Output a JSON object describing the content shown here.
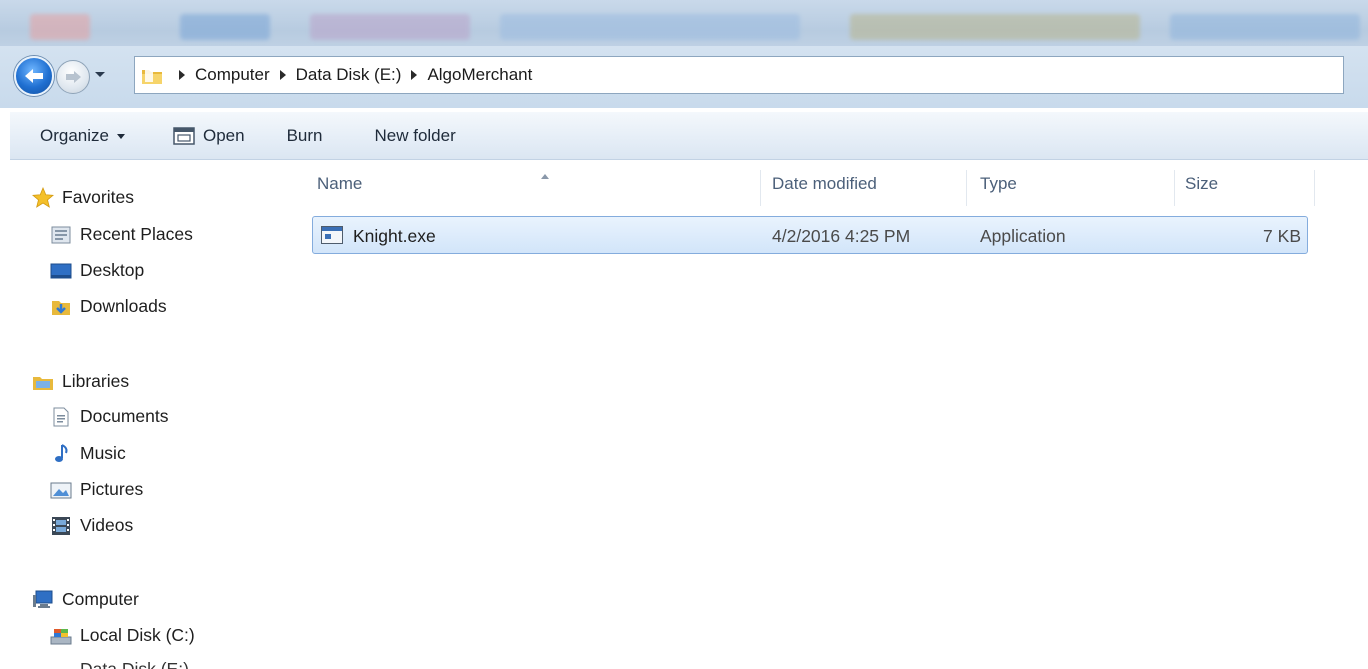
{
  "address": {
    "crumbs": [
      "Computer",
      "Data Disk (E:)",
      "AlgoMerchant"
    ]
  },
  "toolbar": {
    "organize_label": "Organize",
    "open_label": "Open",
    "burn_label": "Burn",
    "new_folder_label": "New folder"
  },
  "nav": {
    "favorites": "Favorites",
    "recent_places": "Recent Places",
    "desktop": "Desktop",
    "downloads": "Downloads",
    "libraries": "Libraries",
    "documents": "Documents",
    "music": "Music",
    "pictures": "Pictures",
    "videos": "Videos",
    "computer": "Computer",
    "local_disk": "Local Disk (C:)",
    "data_disk": "Data Disk (E:)"
  },
  "columns": {
    "name": "Name",
    "date_modified": "Date modified",
    "type": "Type",
    "size": "Size"
  },
  "files": [
    {
      "name": "Knight.exe",
      "date_modified": "4/2/2016 4:25 PM",
      "type": "Application",
      "size": "7 KB"
    }
  ],
  "colors": {
    "accent": "#1f6fd1",
    "selection_border": "#84acdd",
    "selection_fill": "#d2e5fa",
    "toolbar_text": "#1f2b3a",
    "header_text": "#4c607a"
  },
  "icons": {
    "back": "back-arrow-icon",
    "forward": "forward-arrow-icon",
    "folder": "folder-icon",
    "favorites": "star-icon",
    "application": "exe-icon"
  }
}
